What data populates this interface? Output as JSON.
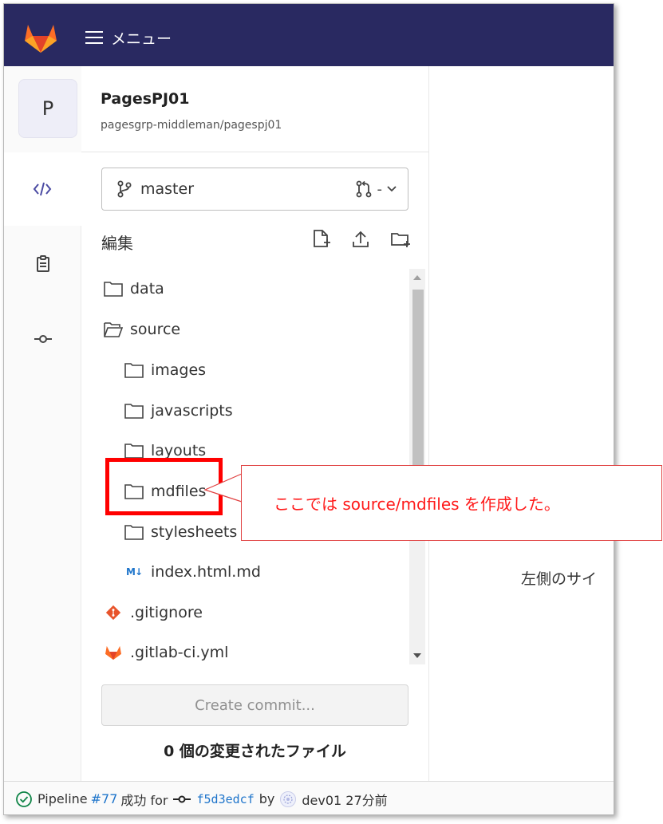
{
  "topbar": {
    "menu_label": "メニュー"
  },
  "project": {
    "avatar_letter": "P",
    "name": "PagesPJ01",
    "path": "pagesgrp-middleman/pagespj01"
  },
  "branch": {
    "name": "master",
    "mr_label": "-"
  },
  "editor": {
    "title": "編集"
  },
  "tree": [
    {
      "name": "data",
      "type": "folder",
      "depth": 0
    },
    {
      "name": "source",
      "type": "folder-open",
      "depth": 0
    },
    {
      "name": "images",
      "type": "folder",
      "depth": 1
    },
    {
      "name": "javascripts",
      "type": "folder",
      "depth": 1
    },
    {
      "name": "layouts",
      "type": "folder",
      "depth": 1
    },
    {
      "name": "mdfiles",
      "type": "folder",
      "depth": 1
    },
    {
      "name": "stylesheets",
      "type": "folder",
      "depth": 1
    },
    {
      "name": "index.html.md",
      "type": "markdown",
      "depth": 1
    },
    {
      "name": ".gitignore",
      "type": "git",
      "depth": 0
    },
    {
      "name": ".gitlab-ci.yml",
      "type": "gitlab",
      "depth": 0
    }
  ],
  "commit": {
    "button_label": "Create commit...",
    "changes_text": "0 個の変更されたファイル"
  },
  "right_panel": {
    "text": "左側のサイ"
  },
  "status": {
    "pipeline_label": "Pipeline",
    "pipeline_id": "#77",
    "result": "成功 for",
    "sha": "f5d3edcf",
    "by": "by",
    "user_time": "dev01 27分前"
  },
  "annotation": {
    "callout_text": "ここでは source/mdfiles を作成した。"
  },
  "colors": {
    "topbar": "#292961",
    "link": "#1f75cb",
    "annotation": "#ff0000"
  }
}
